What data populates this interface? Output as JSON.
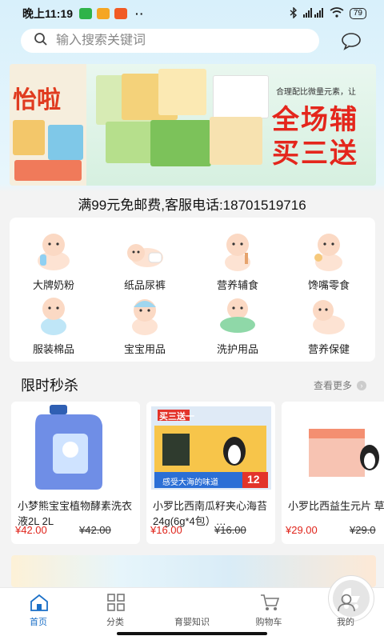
{
  "status_bar": {
    "time": "晚上11:19",
    "more": "··",
    "network": "HD",
    "battery": "79"
  },
  "search": {
    "placeholder": "输入搜索关键词"
  },
  "banner": {
    "left_slogan": "怡啦",
    "right_caption": "合理配比微量元素，让",
    "promo_line1": "全场辅",
    "promo_line2": "买三送"
  },
  "shipping_notice": "满99元免邮费,客服电话:18701519716",
  "categories": [
    {
      "label": "大牌奶粉",
      "icon": "baby-milk-icon"
    },
    {
      "label": "纸品尿裤",
      "icon": "baby-diaper-icon"
    },
    {
      "label": "营养辅食",
      "icon": "baby-food-icon"
    },
    {
      "label": "馋嘴零食",
      "icon": "baby-snack-icon"
    },
    {
      "label": "服装棉品",
      "icon": "baby-clothes-icon"
    },
    {
      "label": "宝宝用品",
      "icon": "baby-supplies-icon"
    },
    {
      "label": "洗护用品",
      "icon": "baby-bath-icon"
    },
    {
      "label": "营养保健",
      "icon": "baby-health-icon"
    }
  ],
  "flash_sale": {
    "title": "限时秒杀",
    "more_label": "查看更多",
    "products": [
      {
        "name": "小梦熊宝宝植物酵素洗衣液2L 2L",
        "price": "¥42.00",
        "original_price": "¥42.00"
      },
      {
        "name": "小罗比西南瓜籽夹心海苔24g(6g*4包）…",
        "price": "¥16.00",
        "original_price": "¥16.00",
        "badge": "买三送一",
        "promo_number": "12",
        "promo_text": "感受大海的味道"
      },
      {
        "name": "小罗比西益生元片 草莓",
        "price": "¥29.00",
        "original_price": "¥29.0"
      }
    ]
  },
  "tabbar": {
    "items": [
      {
        "label": "首页",
        "icon": "home-icon",
        "active": true
      },
      {
        "label": "分类",
        "icon": "category-grid-icon",
        "active": false
      },
      {
        "label": "育婴知识",
        "icon": "stroller-icon",
        "active": false
      },
      {
        "label": "购物车",
        "icon": "cart-icon",
        "active": false
      },
      {
        "label": "我的",
        "icon": "user-icon",
        "active": false
      }
    ]
  },
  "colors": {
    "accent": "#1a6fc7",
    "price": "#e0251c",
    "promo": "#e4261c"
  }
}
